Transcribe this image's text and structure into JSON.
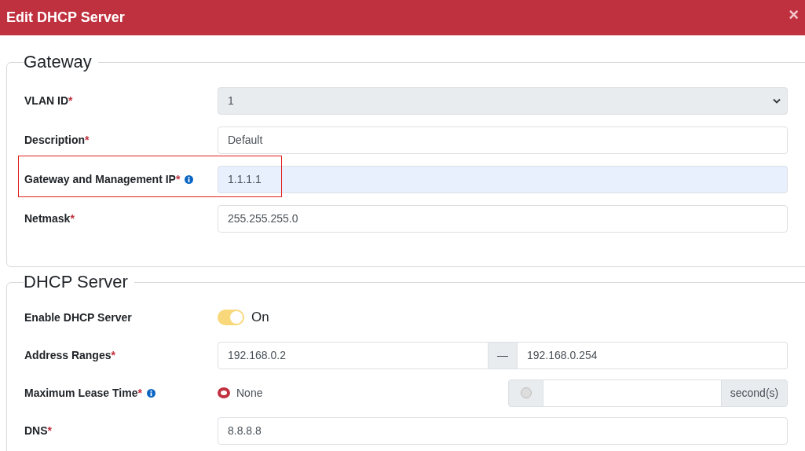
{
  "dialog": {
    "title": "Edit DHCP Server",
    "close": "×"
  },
  "sections": [
    {
      "legend": "Gateway",
      "kind": "gateway",
      "rows": [
        {
          "kind": "select",
          "label": "VLAN ID",
          "required": "*",
          "value": "1",
          "highlighted": false
        },
        {
          "kind": "text",
          "label": "Description",
          "required": "*",
          "value": "Default",
          "autofilled": false,
          "highlighted": false
        },
        {
          "kind": "text",
          "label": "Gateway and Management IP",
          "required": "*",
          "info": true,
          "value": "1.1.1.1",
          "autofilled": true,
          "highlighted": true
        },
        {
          "kind": "text",
          "label": "Netmask",
          "required": "*",
          "value": "255.255.255.0",
          "autofilled": false,
          "highlighted": false
        }
      ]
    },
    {
      "legend": "DHCP Server",
      "kind": "dhcp",
      "rows": [
        {
          "kind": "toggle",
          "label": "Enable DHCP Server",
          "on": true,
          "state_text": "On",
          "highlighted": false
        },
        {
          "kind": "range",
          "label": "Address Ranges",
          "required": "*",
          "start": "192.168.0.2",
          "separator": "—",
          "end": "192.168.0.254",
          "highlighted": false
        },
        {
          "kind": "lease",
          "label": "Maximum Lease Time",
          "required": "*",
          "info": true,
          "none_option": {
            "label": "None",
            "selected": true
          },
          "custom_option": {
            "selected": false,
            "unit": "second(s)"
          },
          "highlighted": false
        },
        {
          "kind": "text",
          "label": "DNS",
          "required": "*",
          "value": "8.8.8.8",
          "autofilled": false,
          "highlighted": false
        }
      ]
    }
  ]
}
